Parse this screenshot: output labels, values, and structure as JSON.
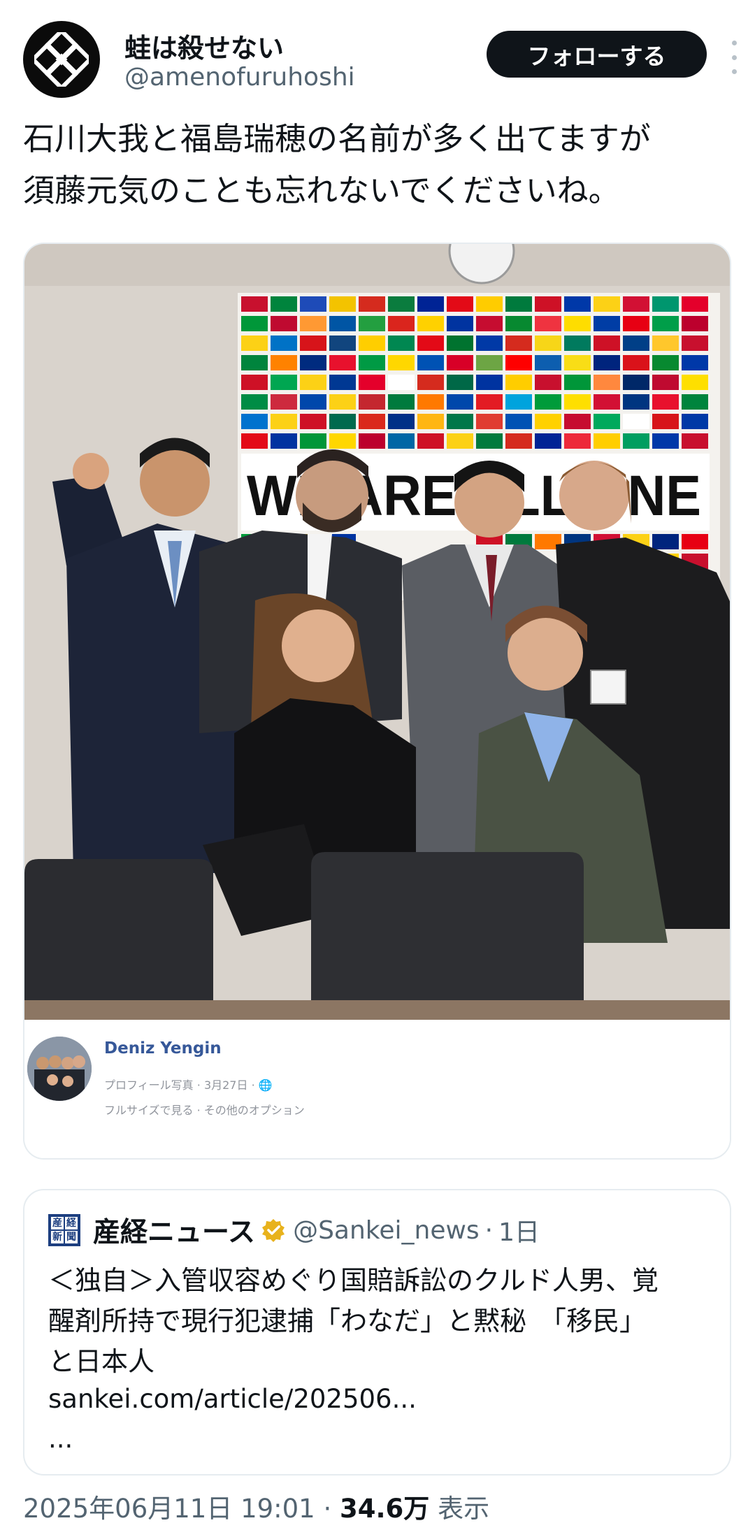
{
  "author": {
    "name": "蛙は殺せない",
    "handle": "@amenofuruhoshi",
    "avatar_icon": "knot-emblem-icon"
  },
  "actions": {
    "follow_label": "フォローする",
    "more_icon": "more-vertical-icon"
  },
  "tweet": {
    "text": "石川大我と福島瑞穂の名前が多く出てますが\n須藤元気のことも忘れないでくださいね。"
  },
  "media": {
    "banner_text": "WE ARE ALL ONE",
    "facebook": {
      "name": "Deniz Yengin",
      "meta": "プロフィール写真 · 3月27日 · 🌐",
      "options": "フルサイズで見る · その他のオプション"
    }
  },
  "quote": {
    "logo_chars": [
      "産",
      "経",
      "新",
      "聞"
    ],
    "name": "産経ニュース",
    "handle": "@Sankei_news",
    "separator": "·",
    "time": "1日",
    "lines": [
      "＜独自＞入管収容めぐり国賠訴訟のクルド人男、覚",
      "醒剤所持で現行犯逮捕「わなだ」と黙秘　「移民」",
      "と日本人"
    ],
    "link": "sankei.com/article/202506...",
    "more": "..."
  },
  "footer": {
    "datetime": "2025年06月11日 19:01",
    "separator": " · ",
    "views": "34.6万",
    "views_label": " 表示"
  },
  "colors": {
    "text": "#0f1419",
    "secondary": "#536471",
    "border": "#e6ecf0",
    "verified": "#e8b21c",
    "fb_link": "#365899"
  }
}
